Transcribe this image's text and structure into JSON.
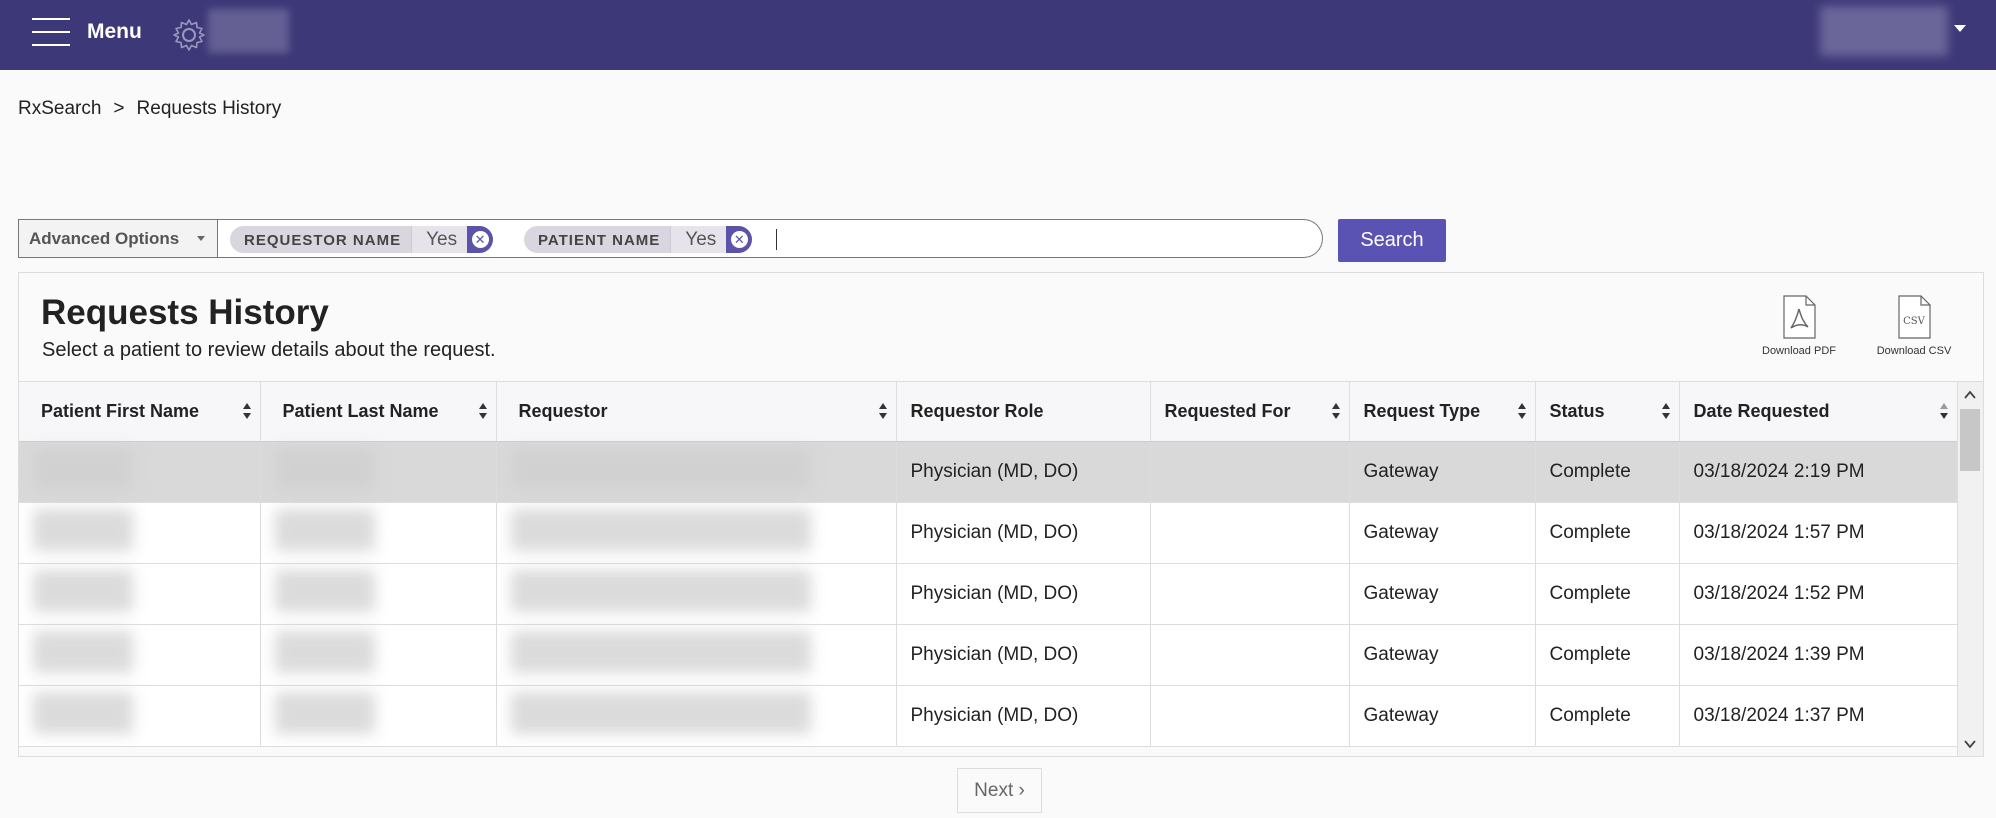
{
  "header": {
    "menu_label": "Menu",
    "icons": [
      "hamburger-icon",
      "gear-icon",
      "chevron-down-icon"
    ],
    "color": "#3d3877"
  },
  "breadcrumb": {
    "root": "RxSearch",
    "separator": ">",
    "current": "Requests History"
  },
  "search": {
    "advanced_label": "Advanced Options",
    "chips": [
      {
        "key": "REQUESTOR NAME",
        "value": "Yes"
      },
      {
        "key": "PATIENT NAME",
        "value": "Yes"
      }
    ],
    "button_label": "Search",
    "button_color": "#5b53b4"
  },
  "panel": {
    "title": "Requests History",
    "subtitle": "Select a patient to review details about the request.",
    "download_pdf": "Download PDF",
    "download_csv": "Download CSV",
    "csv_glyph": "CSV"
  },
  "table": {
    "columns": [
      "Patient First Name",
      "Patient Last Name",
      "Requestor",
      "Requestor Role",
      "Requested For",
      "Request Type",
      "Status",
      "Date Requested"
    ],
    "rows": [
      {
        "role": "Physician (MD, DO)",
        "requested_for": "",
        "type": "Gateway",
        "status": "Complete",
        "date": "03/18/2024 2:19 PM"
      },
      {
        "role": "Physician (MD, DO)",
        "requested_for": "",
        "type": "Gateway",
        "status": "Complete",
        "date": "03/18/2024 1:57 PM"
      },
      {
        "role": "Physician (MD, DO)",
        "requested_for": "",
        "type": "Gateway",
        "status": "Complete",
        "date": "03/18/2024 1:52 PM"
      },
      {
        "role": "Physician (MD, DO)",
        "requested_for": "",
        "type": "Gateway",
        "status": "Complete",
        "date": "03/18/2024 1:39 PM"
      },
      {
        "role": "Physician (MD, DO)",
        "requested_for": "",
        "type": "Gateway",
        "status": "Complete",
        "date": "03/18/2024 1:37 PM"
      }
    ]
  },
  "pagination": {
    "next_label": "Next ›"
  }
}
